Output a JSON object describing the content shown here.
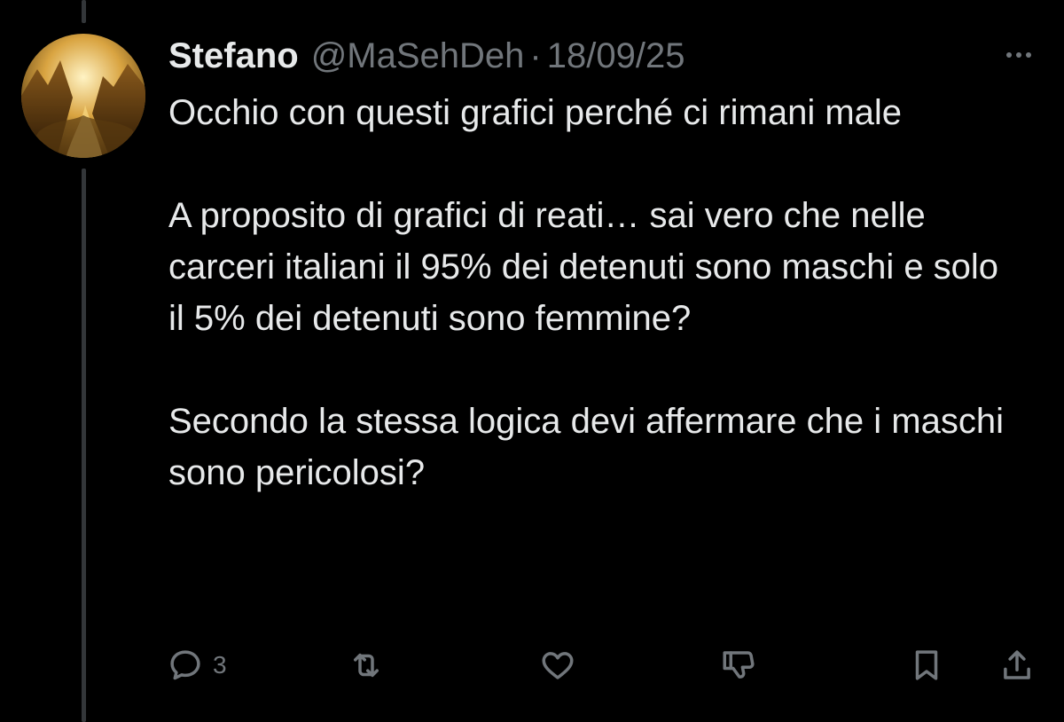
{
  "post": {
    "author_name": "Stefano",
    "author_handle": "@MaSehDeh",
    "separator": "·",
    "date": "18/09/25",
    "paragraphs": [
      "Occhio con questi grafici perché ci rimani male",
      "A proposito di grafici di reati… sai vero che nelle carceri italiani il 95% dei detenuti sono maschi e solo il 5% dei detenuti sono femmine?",
      "Secondo la stessa logica devi affermare che i maschi sono pericolosi?"
    ]
  },
  "actions": {
    "reply_count": "3",
    "icons": [
      "reply-icon",
      "repost-icon",
      "like-icon",
      "dislike-icon",
      "bookmark-icon",
      "share-icon"
    ]
  },
  "colors": {
    "background": "#000000",
    "text": "#e7e9ea",
    "muted": "#71767b",
    "thread_line": "#333639"
  }
}
